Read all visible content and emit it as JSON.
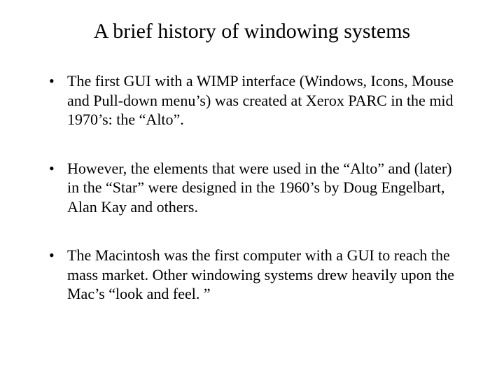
{
  "slide": {
    "title": "A brief history of windowing systems",
    "bullets": [
      "The first GUI with a WIMP interface (Windows, Icons, Mouse and Pull-down menu’s) was created at Xerox PARC in the mid 1970’s:  the “Alto”.",
      "However, the elements that were used in the “Alto” and (later) in the “Star” were designed in the 1960’s by Doug Engelbart, Alan Kay and others.",
      "The Macintosh was the first computer with a GUI to reach the mass market.  Other windowing systems drew heavily upon the Mac’s “look and feel. ”"
    ]
  }
}
